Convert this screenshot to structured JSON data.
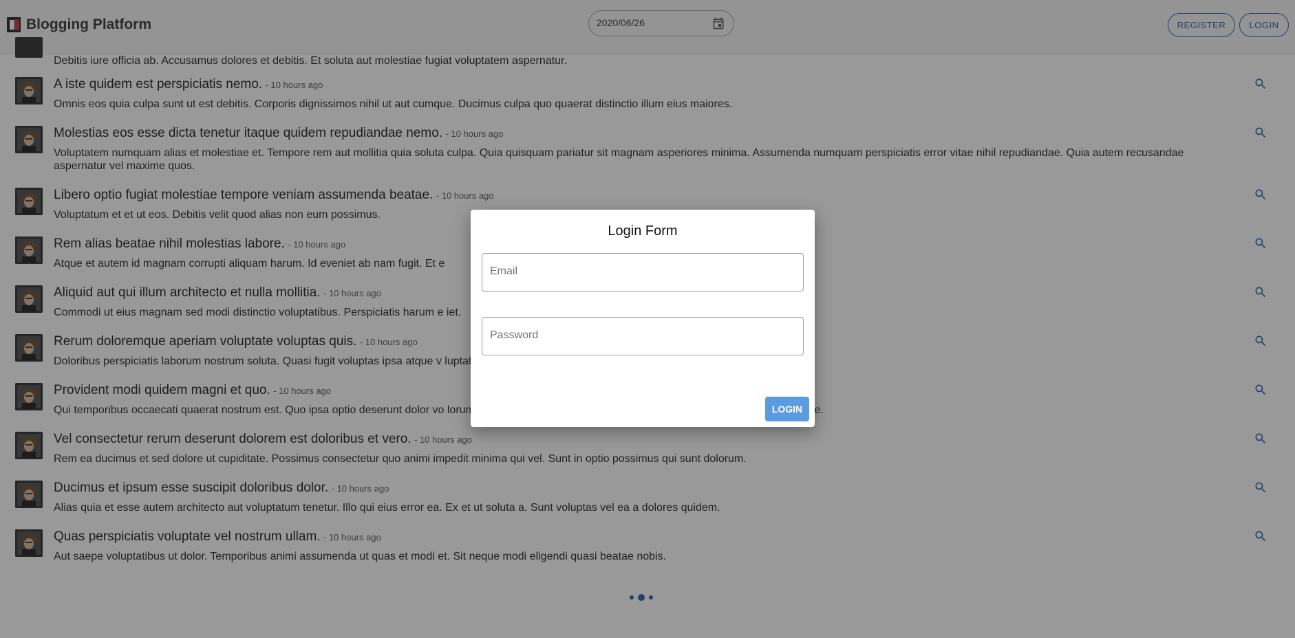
{
  "header": {
    "title": "Blogging Platform",
    "date_value": "2020/06/26",
    "register_label": "REGISTER",
    "login_label": "LOGIN"
  },
  "posts": {
    "partial_body": "Debitis iure officia ab. Accusamus dolores et debitis. Et soluta aut molestiae fugiat voluptatem aspernatur.",
    "items": [
      {
        "title": "A iste quidem est perspiciatis nemo.",
        "time": "- 10 hours ago",
        "body": "Omnis eos quia culpa sunt ut est debitis. Corporis dignissimos nihil ut aut cumque. Ducimus culpa quo quaerat distinctio illum eius maiores."
      },
      {
        "title": "Molestias eos esse dicta tenetur itaque quidem repudiandae nemo.",
        "time": "- 10 hours ago",
        "body": "Voluptatem numquam alias et molestiae et. Tempore rem aut mollitia quia soluta culpa. Quia quisquam pariatur sit magnam asperiores minima. Assumenda numquam perspiciatis error vitae nihil repudiandae. Quia autem recusandae aspernatur vel maxime quos."
      },
      {
        "title": "Libero optio fugiat molestiae tempore veniam assumenda beatae.",
        "time": "- 10 hours ago",
        "body": "Voluptatum et et ut eos. Debitis velit quod alias non eum possimus."
      },
      {
        "title": "Rem alias beatae nihil molestias labore.",
        "time": "- 10 hours ago",
        "body": "Atque et autem id magnam corrupti aliquam harum. Id eveniet ab nam fugit. Et e"
      },
      {
        "title": "Aliquid aut qui illum architecto et nulla mollitia.",
        "time": "- 10 hours ago",
        "body": "Commodi ut eius magnam sed modi distinctio voluptatibus. Perspiciatis harum e                                                                                                                  iet."
      },
      {
        "title": "Rerum doloremque aperiam voluptate voluptas quis.",
        "time": "- 10 hours ago",
        "body": "Doloribus perspiciatis laborum nostrum soluta. Quasi fugit voluptas ipsa atque v                                                                                             luptatum tempore hic suscipit nisi rerum et."
      },
      {
        "title": "Provident modi quidem magni et quo.",
        "time": "- 10 hours ago",
        "body": "Qui temporibus occaecati quaerat nostrum est. Quo ipsa optio deserunt dolor vo                                                                                              lorum quos ut. Voluptatum corporis cupiditate distinctio dolorem repudiandae."
      },
      {
        "title": "Vel consectetur rerum deserunt dolorem est doloribus et vero.",
        "time": "- 10 hours ago",
        "body": "Rem ea ducimus et sed dolore ut cupiditate. Possimus consectetur quo animi impedit minima qui vel. Sunt in optio possimus qui sunt dolorum."
      },
      {
        "title": "Ducimus et ipsum esse suscipit doloribus dolor.",
        "time": "- 10 hours ago",
        "body": "Alias quia et esse autem architecto aut voluptatum tenetur. Illo qui eius error ea. Ex et ut soluta a. Sunt voluptas vel ea a dolores quidem."
      },
      {
        "title": "Quas perspiciatis voluptate vel nostrum ullam.",
        "time": "- 10 hours ago",
        "body": "Aut saepe voluptatibus ut dolor. Temporibus animi assumenda ut quas et modi et. Sit neque modi eligendi quasi beatae nobis."
      }
    ]
  },
  "pagination": {
    "pages": 3,
    "current": 2
  },
  "dialog": {
    "title": "Login Form",
    "email_placeholder": "Email",
    "password_placeholder": "Password",
    "submit_label": "LOGIN"
  },
  "colors": {
    "accent": "#1e5fa8",
    "button": "#5b9be0",
    "brand_red": "#d32f2f"
  }
}
